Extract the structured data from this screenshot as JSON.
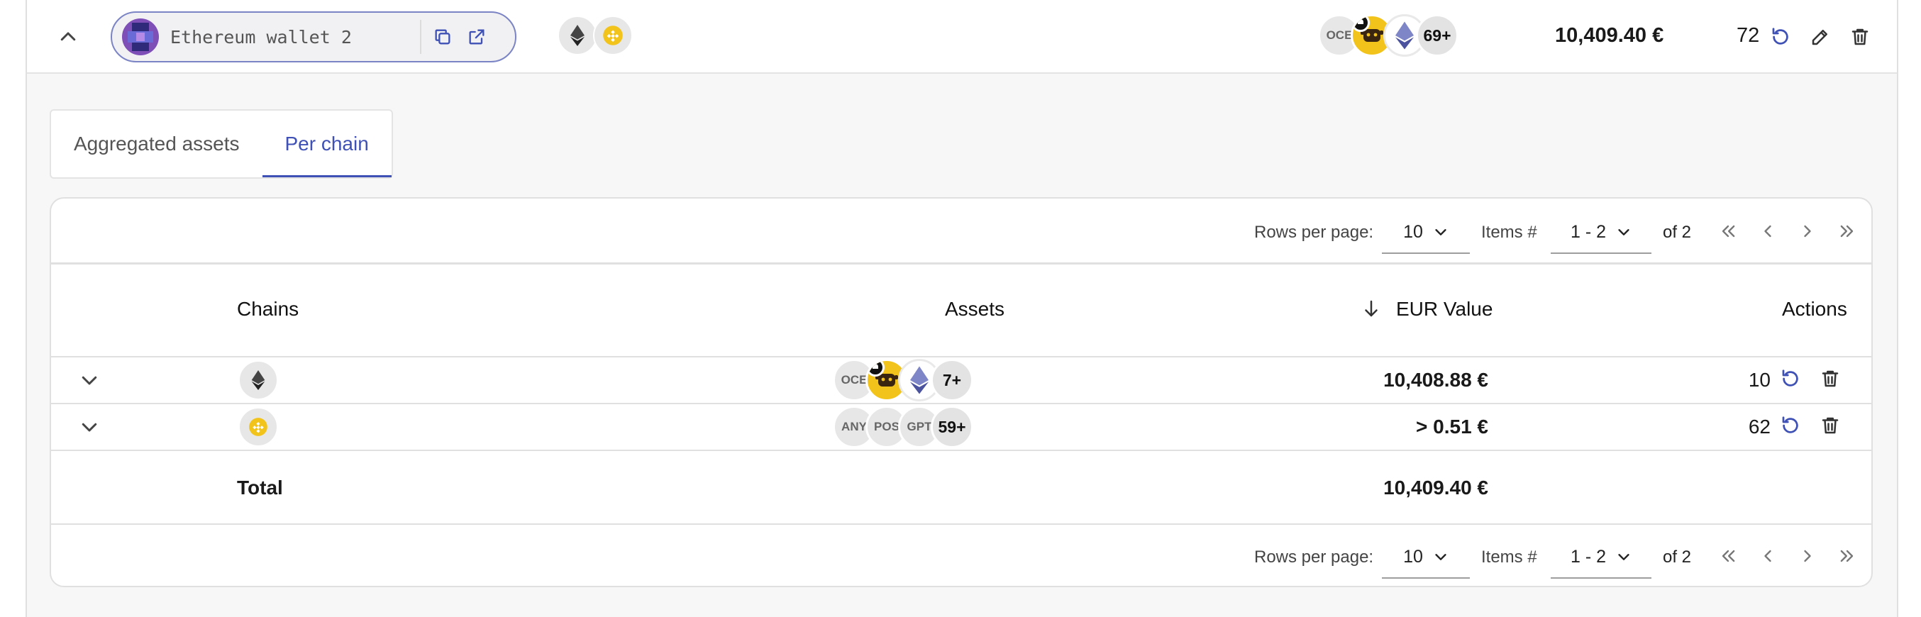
{
  "account": {
    "label": "Ethereum wallet 2",
    "chains": [
      "ethereum-icon",
      "bnb-chain-icon"
    ],
    "assets": [
      "OCE",
      "",
      "",
      "69+"
    ],
    "value": "10,409.40 €",
    "count": "72"
  },
  "tabs": [
    {
      "label": "Aggregated assets",
      "active": false
    },
    {
      "label": "Per chain",
      "active": true
    }
  ],
  "pagination": {
    "rows_per_page_label": "Rows per page:",
    "rows_per_page_value": "10",
    "items_label": "Items #",
    "items_value": "1 - 2",
    "of_label": "of 2"
  },
  "table": {
    "headers": {
      "chains": "Chains",
      "assets": "Assets",
      "value": "EUR Value",
      "actions": "Actions"
    },
    "rows": [
      {
        "chain_icon": "ethereum-icon",
        "assets": [
          "OCE",
          "",
          "",
          "7+"
        ],
        "value": "10,408.88 €",
        "count": "10"
      },
      {
        "chain_icon": "bnb-chain-icon",
        "assets": [
          "ANY",
          "POS",
          "GPT",
          "59+"
        ],
        "value": "> 0.51 €",
        "count": "62"
      }
    ],
    "total": {
      "label": "Total",
      "value": "10,409.40 €"
    }
  },
  "colors": {
    "accent": "#3f51b5",
    "bnb_yellow": "#f2c31a",
    "pill_border": "#7b84c4"
  }
}
